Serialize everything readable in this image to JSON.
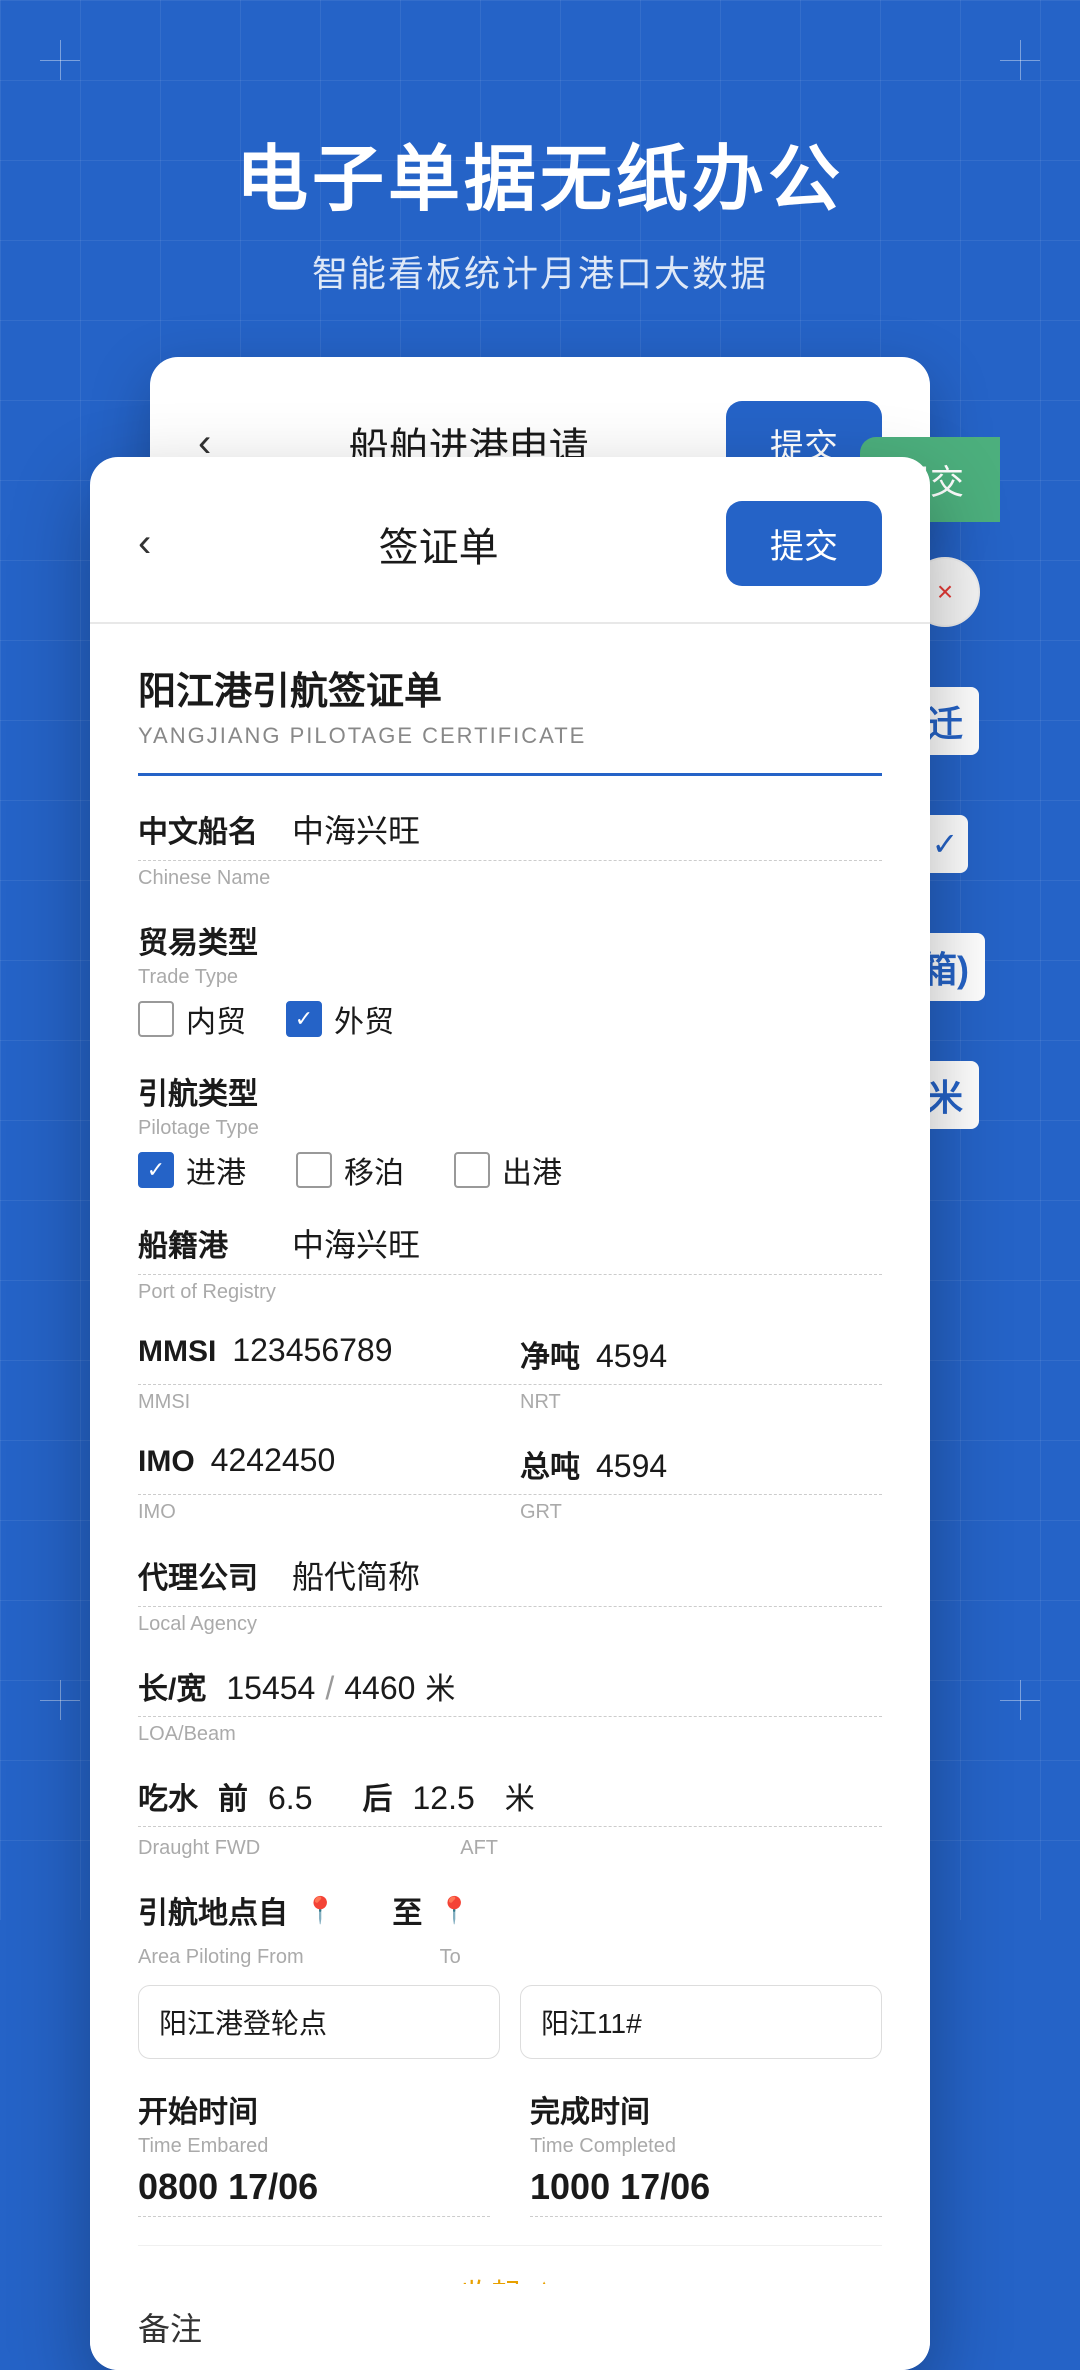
{
  "hero": {
    "title": "电子单据无纸办公",
    "subtitle": "智能看板统计月港口大数据"
  },
  "back_card": {
    "title": "船舶进港申请",
    "submit_label": "提交"
  },
  "front_card": {
    "title": "签证单",
    "submit_label": "提交",
    "cert_title_zh": "阳江港引航签证单",
    "cert_title_en": "YANGJIANG PILOTAGE CERTIFICATE",
    "fields": {
      "chinese_name_zh": "中文船名",
      "chinese_name_en": "Chinese Name",
      "chinese_name_value": "中海兴旺",
      "trade_type_zh": "贸易类型",
      "trade_type_en": "Trade Type",
      "trade_inner": "内贸",
      "trade_outer": "外贸",
      "trade_inner_checked": false,
      "trade_outer_checked": true,
      "pilotage_type_zh": "引航类型",
      "pilotage_type_en": "Pilotage Type",
      "pilotage_enter": "进港",
      "pilotage_move": "移泊",
      "pilotage_exit": "出港",
      "pilotage_enter_checked": true,
      "pilotage_move_checked": false,
      "pilotage_exit_checked": false,
      "port_registry_zh": "船籍港",
      "port_registry_en": "Port of Registry",
      "port_registry_value": "中海兴旺",
      "mmsi_zh": "MMSI",
      "mmsi_en": "MMSI",
      "mmsi_value": "123456789",
      "nrt_zh": "净吨",
      "nrt_en": "NRT",
      "nrt_value": "4594",
      "imo_zh": "IMO",
      "imo_en": "IMO",
      "imo_value": "4242450",
      "grt_zh": "总吨",
      "grt_en": "GRT",
      "grt_value": "4594",
      "agency_zh": "代理公司",
      "agency_en": "Local Agency",
      "agency_value": "船代简称",
      "loa_zh": "长/宽",
      "loa_en": "LOA/Beam",
      "loa_value": "15454",
      "beam_value": "4460",
      "loa_unit": "米",
      "draught_zh": "吃水",
      "draught_fwd_zh": "前",
      "draught_fwd_en": "Draught FWD",
      "draught_fwd_value": "6.5",
      "draught_aft_zh": "后",
      "draught_aft_en": "AFT",
      "draught_aft_value": "12.5",
      "draught_unit": "米",
      "area_from_zh": "引航地点自",
      "area_from_en": "Area Piloting From",
      "area_to_zh": "至",
      "area_to_en": "To",
      "area_from_value": "阳江港登轮点",
      "area_to_value": "阳江11#",
      "time_start_zh": "开始时间",
      "time_start_en": "Time Embared",
      "time_start_value": "0800 17/06",
      "time_end_zh": "完成时间",
      "time_end_en": "Time Completed",
      "time_end_value": "1000 17/06",
      "collapse_label": "收起 ∧",
      "bottom_partial": "备注"
    }
  },
  "peek": {
    "close_icon": "×",
    "blue_text": "迁",
    "check_icon": "✓",
    "bracket_text": "箱)",
    "right_text": "米"
  }
}
